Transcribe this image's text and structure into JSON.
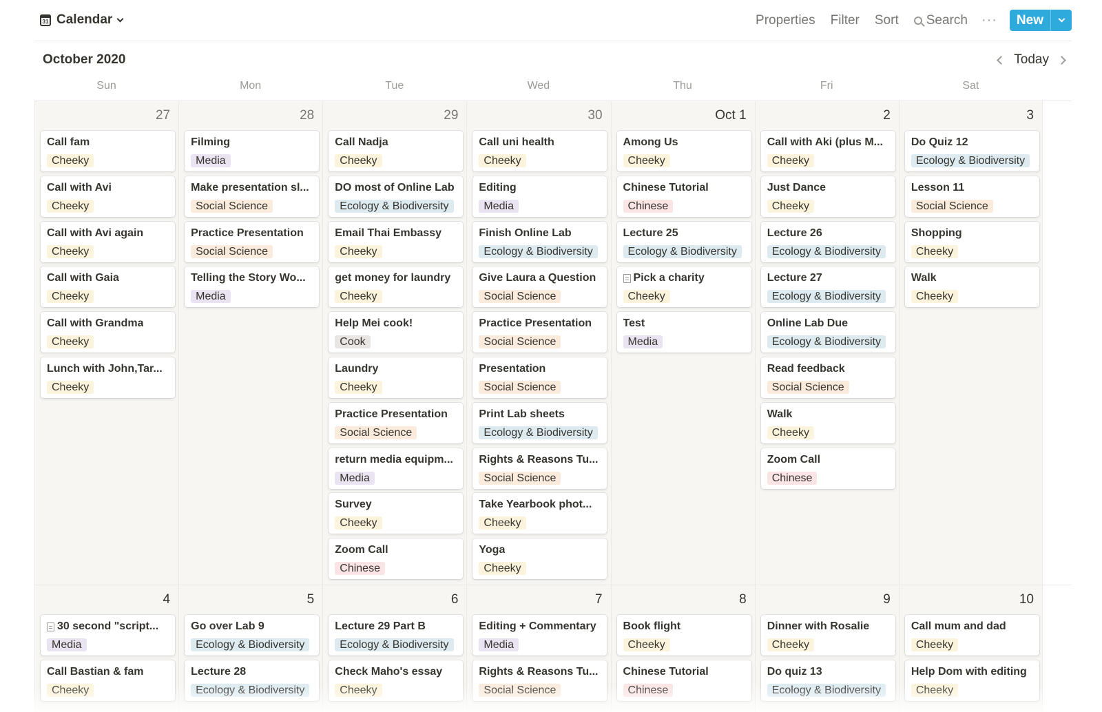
{
  "view": {
    "title": "Calendar",
    "icon": "calendar-icon",
    "icon_label": "31"
  },
  "toolbar": {
    "properties": "Properties",
    "filter": "Filter",
    "sort": "Sort",
    "search": "Search",
    "more": "···",
    "new": "New"
  },
  "month": {
    "title": "October 2020",
    "today": "Today"
  },
  "weekdays": [
    "Sun",
    "Mon",
    "Tue",
    "Wed",
    "Thu",
    "Fri",
    "Sat"
  ],
  "colors": {
    "accent": "#2eaadc",
    "cheeky": "#fbf3db",
    "eco": "#ddebf1",
    "social": "#faebdd",
    "media": "#eae4f2",
    "chinese": "#fbe4e4",
    "cook": "#e9e5e3"
  },
  "weeks": [
    {
      "days": [
        {
          "label": "27",
          "muted": true,
          "events": [
            {
              "title": "Call fam",
              "tag": "Cheeky",
              "kind": "cheeky"
            },
            {
              "title": "Call with Avi",
              "tag": "Cheeky",
              "kind": "cheeky"
            },
            {
              "title": "Call with Avi again",
              "tag": "Cheeky",
              "kind": "cheeky"
            },
            {
              "title": "Call with Gaia",
              "tag": "Cheeky",
              "kind": "cheeky"
            },
            {
              "title": "Call with Grandma",
              "tag": "Cheeky",
              "kind": "cheeky"
            },
            {
              "title": "Lunch with John,Tar...",
              "tag": "Cheeky",
              "kind": "cheeky"
            }
          ]
        },
        {
          "label": "28",
          "muted": true,
          "events": [
            {
              "title": "Filming",
              "tag": "Media",
              "kind": "media"
            },
            {
              "title": "Make presentation sl...",
              "tag": "Social Science",
              "kind": "social"
            },
            {
              "title": "Practice Presentation",
              "tag": "Social Science",
              "kind": "social"
            },
            {
              "title": "Telling the Story Wo...",
              "tag": "Media",
              "kind": "media"
            }
          ]
        },
        {
          "label": "29",
          "muted": true,
          "events": [
            {
              "title": "Call Nadja",
              "tag": "Cheeky",
              "kind": "cheeky"
            },
            {
              "title": "DO most of Online Lab",
              "tag": "Ecology & Biodiversity",
              "kind": "eco"
            },
            {
              "title": "Email Thai Embassy",
              "tag": "Cheeky",
              "kind": "cheeky"
            },
            {
              "title": "get money for laundry",
              "tag": "Cheeky",
              "kind": "cheeky"
            },
            {
              "title": "Help Mei cook!",
              "tag": "Cook",
              "kind": "cook"
            },
            {
              "title": "Laundry",
              "tag": "Cheeky",
              "kind": "cheeky"
            },
            {
              "title": "Practice Presentation",
              "tag": "Social Science",
              "kind": "social"
            },
            {
              "title": "return media equipm...",
              "tag": "Media",
              "kind": "media"
            },
            {
              "title": "Survey",
              "tag": "Cheeky",
              "kind": "cheeky"
            },
            {
              "title": "Zoom Call",
              "tag": "Chinese",
              "kind": "chinese"
            }
          ]
        },
        {
          "label": "30",
          "muted": true,
          "events": [
            {
              "title": "Call uni health",
              "tag": "Cheeky",
              "kind": "cheeky"
            },
            {
              "title": "Editing",
              "tag": "Media",
              "kind": "media"
            },
            {
              "title": "Finish Online Lab",
              "tag": "Ecology & Biodiversity",
              "kind": "eco"
            },
            {
              "title": "Give Laura a Question",
              "tag": "Social Science",
              "kind": "social"
            },
            {
              "title": "Practice Presentation",
              "tag": "Social Science",
              "kind": "social"
            },
            {
              "title": "Presentation",
              "tag": "Social Science",
              "kind": "social"
            },
            {
              "title": "Print Lab sheets",
              "tag": "Ecology & Biodiversity",
              "kind": "eco"
            },
            {
              "title": "Rights & Reasons Tu...",
              "tag": "Social Science",
              "kind": "social"
            },
            {
              "title": "Take Yearbook phot...",
              "tag": "Cheeky",
              "kind": "cheeky"
            },
            {
              "title": "Yoga",
              "tag": "Cheeky",
              "kind": "cheeky"
            }
          ]
        },
        {
          "label": "Oct 1",
          "muted": false,
          "events": [
            {
              "title": "Among Us",
              "tag": "Cheeky",
              "kind": "cheeky"
            },
            {
              "title": "Chinese Tutorial",
              "tag": "Chinese",
              "kind": "chinese"
            },
            {
              "title": "Lecture 25",
              "tag": "Ecology & Biodiversity",
              "kind": "eco"
            },
            {
              "title": "Pick a charity",
              "tag": "Cheeky",
              "kind": "cheeky",
              "doc": true
            },
            {
              "title": "Test",
              "tag": "Media",
              "kind": "media"
            }
          ]
        },
        {
          "label": "2",
          "muted": false,
          "events": [
            {
              "title": "Call with Aki (plus M...",
              "tag": "Cheeky",
              "kind": "cheeky"
            },
            {
              "title": "Just Dance",
              "tag": "Cheeky",
              "kind": "cheeky"
            },
            {
              "title": "Lecture 26",
              "tag": "Ecology & Biodiversity",
              "kind": "eco"
            },
            {
              "title": "Lecture 27",
              "tag": "Ecology & Biodiversity",
              "kind": "eco"
            },
            {
              "title": "Online Lab Due",
              "tag": "Ecology & Biodiversity",
              "kind": "eco"
            },
            {
              "title": "Read feedback",
              "tag": "Social Science",
              "kind": "social"
            },
            {
              "title": "Walk",
              "tag": "Cheeky",
              "kind": "cheeky"
            },
            {
              "title": "Zoom Call",
              "tag": "Chinese",
              "kind": "chinese"
            }
          ]
        },
        {
          "label": "3",
          "muted": false,
          "events": [
            {
              "title": "Do Quiz 12",
              "tag": "Ecology & Biodiversity",
              "kind": "eco"
            },
            {
              "title": "Lesson 11",
              "tag": "Social Science",
              "kind": "social"
            },
            {
              "title": "Shopping",
              "tag": "Cheeky",
              "kind": "cheeky"
            },
            {
              "title": "Walk",
              "tag": "Cheeky",
              "kind": "cheeky"
            }
          ]
        }
      ]
    },
    {
      "days": [
        {
          "label": "4",
          "muted": false,
          "events": [
            {
              "title": "30 second \"script...",
              "tag": "Media",
              "kind": "media",
              "doc": true
            },
            {
              "title": "Call Bastian & fam",
              "tag": "Cheeky",
              "kind": "cheeky"
            }
          ]
        },
        {
          "label": "5",
          "muted": false,
          "events": [
            {
              "title": "Go over Lab 9",
              "tag": "Ecology & Biodiversity",
              "kind": "eco"
            },
            {
              "title": "Lecture 28",
              "tag": "Ecology & Biodiversity",
              "kind": "eco"
            }
          ]
        },
        {
          "label": "6",
          "muted": false,
          "events": [
            {
              "title": "Lecture 29 Part B",
              "tag": "Ecology & Biodiversity",
              "kind": "eco"
            },
            {
              "title": "Check Maho's essay",
              "tag": "Cheeky",
              "kind": "cheeky"
            }
          ]
        },
        {
          "label": "7",
          "muted": false,
          "events": [
            {
              "title": "Editing + Commentary",
              "tag": "Media",
              "kind": "media"
            },
            {
              "title": "Rights & Reasons Tu...",
              "tag": "Social Science",
              "kind": "social"
            }
          ]
        },
        {
          "label": "8",
          "muted": false,
          "events": [
            {
              "title": "Book flight",
              "tag": "Cheeky",
              "kind": "cheeky"
            },
            {
              "title": "Chinese Tutorial",
              "tag": "Chinese",
              "kind": "chinese"
            }
          ]
        },
        {
          "label": "9",
          "muted": false,
          "events": [
            {
              "title": "Dinner with Rosalie",
              "tag": "Cheeky",
              "kind": "cheeky"
            },
            {
              "title": "Do quiz 13",
              "tag": "Ecology & Biodiversity",
              "kind": "eco"
            }
          ]
        },
        {
          "label": "10",
          "muted": false,
          "events": [
            {
              "title": "Call mum and dad",
              "tag": "Cheeky",
              "kind": "cheeky"
            },
            {
              "title": "Help Dom with editing",
              "tag": "Cheeky",
              "kind": "cheeky"
            }
          ]
        }
      ]
    }
  ]
}
